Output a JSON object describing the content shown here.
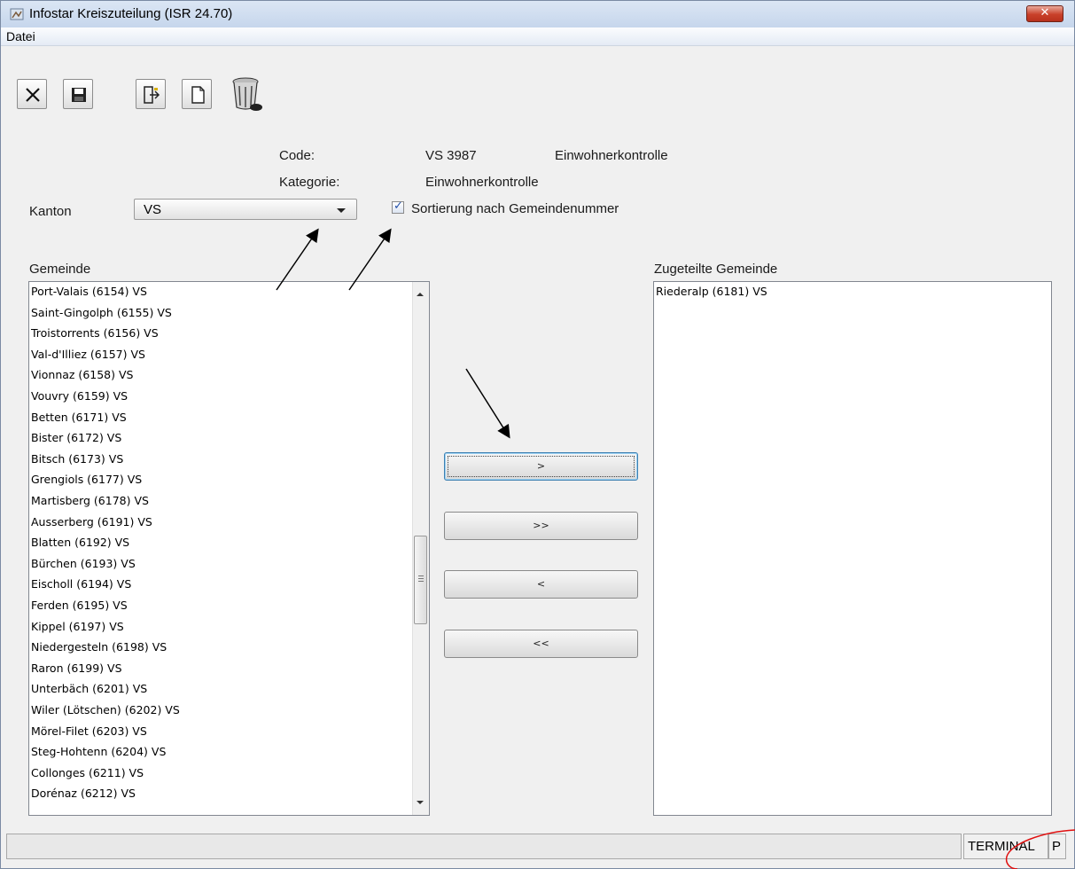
{
  "window": {
    "title": "Infostar Kreiszuteilung (ISR 24.70)",
    "close_glyph": "✕"
  },
  "menu": {
    "items": [
      "Datei"
    ]
  },
  "toolbar": {
    "buttons": [
      {
        "name": "close-icon"
      },
      {
        "name": "save-icon"
      },
      {
        "name": "exit-icon"
      },
      {
        "name": "new-document-icon"
      },
      {
        "name": "trash-icon"
      }
    ]
  },
  "form": {
    "code_label": "Code:",
    "code_value": "VS 3987",
    "code_desc": "Einwohnerkontrolle",
    "kategorie_label": "Kategorie:",
    "kategorie_value": "Einwohnerkontrolle",
    "kanton_label": "Kanton",
    "kanton_value": "VS",
    "sort_checkbox_label": "Sortierung nach Gemeindenummer",
    "sort_checkbox_checked": true
  },
  "gemeinde": {
    "header": "Gemeinde",
    "items": [
      "Port-Valais (6154) VS",
      "Saint-Gingolph (6155) VS",
      "Troistorrents (6156) VS",
      "Val-d'Illiez (6157) VS",
      "Vionnaz (6158) VS",
      "Vouvry (6159) VS",
      "Betten (6171) VS",
      "Bister (6172) VS",
      "Bitsch (6173) VS",
      "Grengiols (6177) VS",
      "Martisberg (6178) VS",
      "Ausserberg (6191) VS",
      "Blatten (6192) VS",
      "Bürchen (6193) VS",
      "Eischoll (6194) VS",
      "Ferden (6195) VS",
      "Kippel (6197) VS",
      "Niedergesteln (6198) VS",
      "Raron (6199) VS",
      "Unterbäch (6201) VS",
      "Wiler (Lötschen) (6202) VS",
      "Mörel-Filet (6203) VS",
      "Steg-Hohtenn (6204) VS",
      "Collonges (6211) VS",
      "Dorénaz (6212) VS"
    ]
  },
  "zugeteilt": {
    "header": "Zugeteilte Gemeinde",
    "items": [
      "Riederalp (6181) VS"
    ]
  },
  "buttons": {
    "add_one": ">",
    "add_all": ">>",
    "remove_one": "<",
    "remove_all": "<<"
  },
  "status": {
    "terminal": "TERMINAL",
    "mode": "P"
  },
  "colors": {
    "annotation_circle": "#e01010",
    "annotation_arrow": "#000000"
  }
}
